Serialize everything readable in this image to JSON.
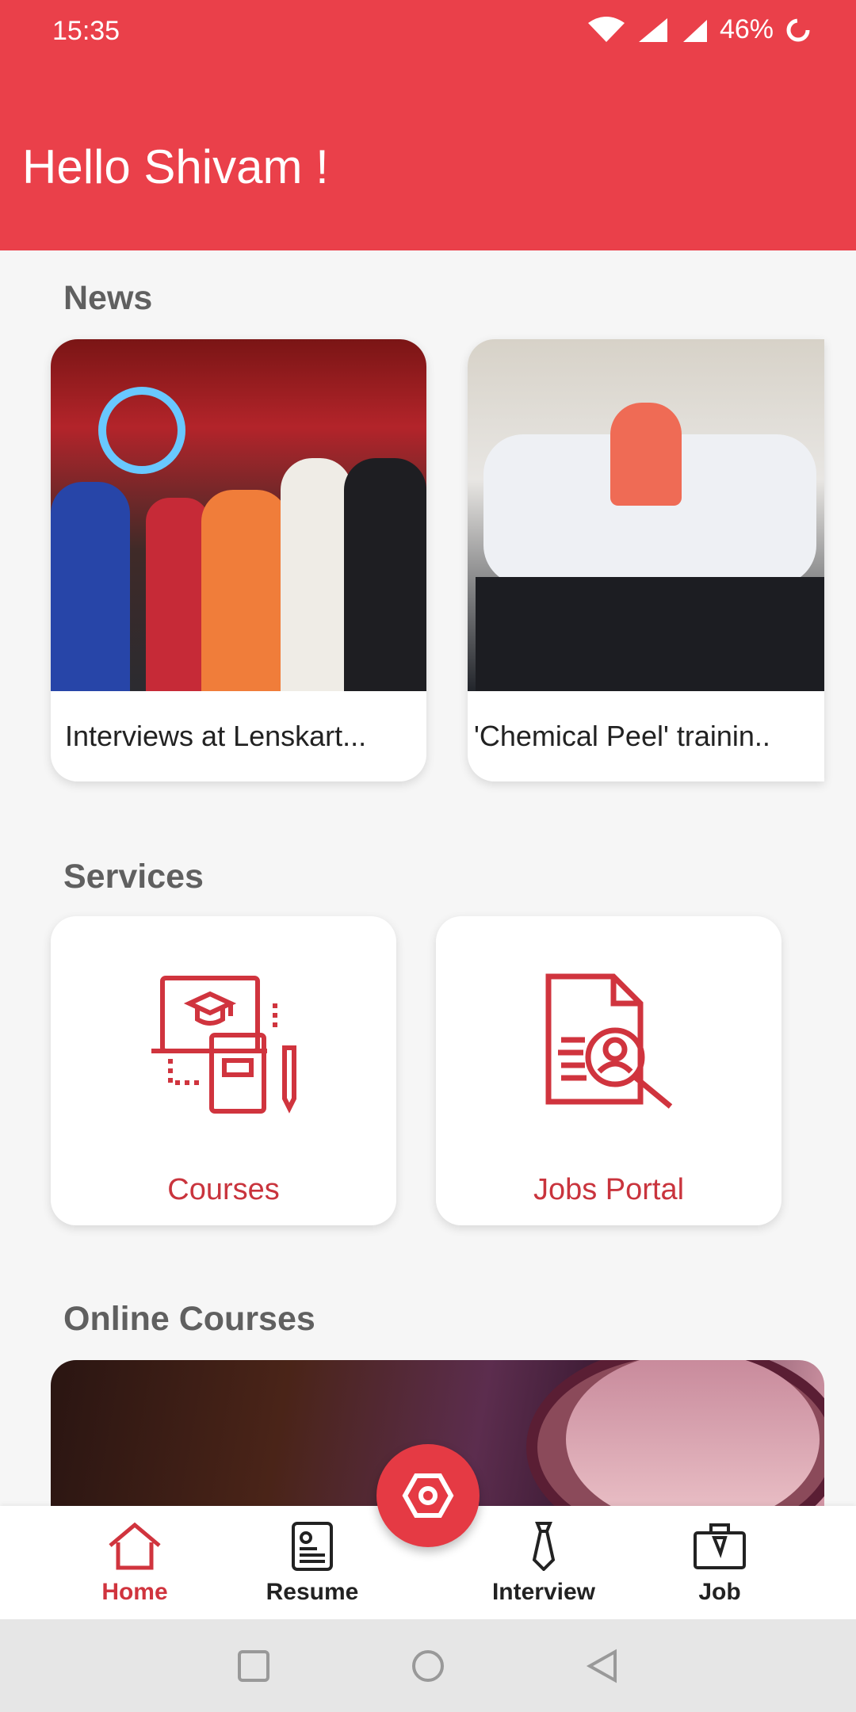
{
  "status_bar": {
    "time": "15:35",
    "battery": "46%"
  },
  "header": {
    "greeting": "Hello Shivam !"
  },
  "news": {
    "title": "News",
    "items": [
      {
        "caption": "Interviews at Lenskart..."
      },
      {
        "caption": "'Chemical Peel' trainin.."
      }
    ]
  },
  "services": {
    "title": "Services",
    "items": [
      {
        "label": "Courses",
        "icon": "courses-icon"
      },
      {
        "label": "Jobs Portal",
        "icon": "job-search-icon"
      }
    ]
  },
  "online_courses": {
    "title": "Online Courses"
  },
  "bottom_nav": {
    "items": [
      {
        "label": "Home",
        "icon": "home-icon",
        "active": true
      },
      {
        "label": "Resume",
        "icon": "resume-icon"
      },
      {
        "label": "Interview",
        "icon": "tie-icon"
      },
      {
        "label": "Job",
        "icon": "briefcase-icon"
      }
    ],
    "fab_icon": "hexagon-icon"
  },
  "colors": {
    "accent": "#ea404a",
    "service_red": "#c9343d"
  }
}
